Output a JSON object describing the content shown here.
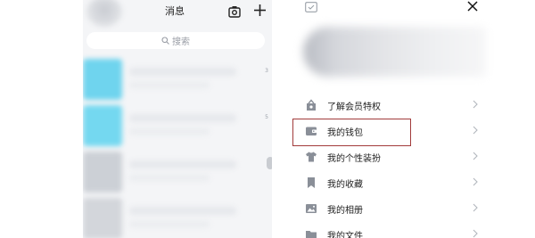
{
  "left_panel": {
    "title": "消息",
    "search_placeholder": "搜索",
    "messages": [
      {
        "badge": "3",
        "avatar_color": "#6fd4ee"
      },
      {
        "badge": "5",
        "avatar_color": "#74d8f0"
      },
      {
        "badge": "",
        "avatar_color": "#ccd0d6"
      },
      {
        "badge": "",
        "avatar_color": "#d3d6db"
      }
    ]
  },
  "right_panel": {
    "menu_items": [
      {
        "label": "了解会员特权",
        "icon": "vip-icon"
      },
      {
        "label": "我的钱包",
        "icon": "wallet-icon"
      },
      {
        "label": "我的个性装扮",
        "icon": "tshirt-icon"
      },
      {
        "label": "我的收藏",
        "icon": "bookmark-icon"
      },
      {
        "label": "我的相册",
        "icon": "photo-album-icon"
      },
      {
        "label": "我的文件",
        "icon": "folder-icon"
      }
    ],
    "highlighted_item": "我的钱包"
  },
  "colors": {
    "icon_gray": "#8a8f98",
    "highlight_border": "#a23b3b",
    "list_background": "#f4f5f7"
  }
}
